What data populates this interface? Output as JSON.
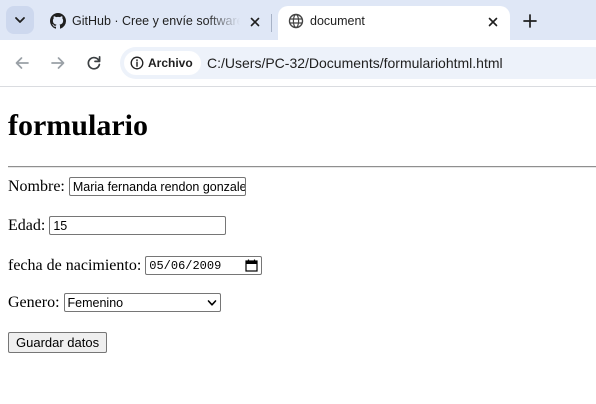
{
  "browser": {
    "tabs": [
      {
        "title": "GitHub · Cree y envíe software con GitHub",
        "favicon": "github-icon",
        "active": false
      },
      {
        "title": "document",
        "favicon": "globe-icon",
        "active": true
      }
    ],
    "address_chip": "Archivo",
    "url": "C:/Users/PC-32/Documents/formulariohtml.html"
  },
  "page": {
    "heading": "formulario",
    "form": {
      "nombre_label": "Nombre:",
      "nombre_value": "Maria fernanda rendon gonzalez",
      "edad_label": "Edad:",
      "edad_value": "15",
      "fecha_label": "fecha de nacimiento:",
      "fecha_value": "05/06/2009",
      "genero_label": "Genero:",
      "genero_value": "Femenino",
      "submit_label": "Guardar datos"
    }
  }
}
